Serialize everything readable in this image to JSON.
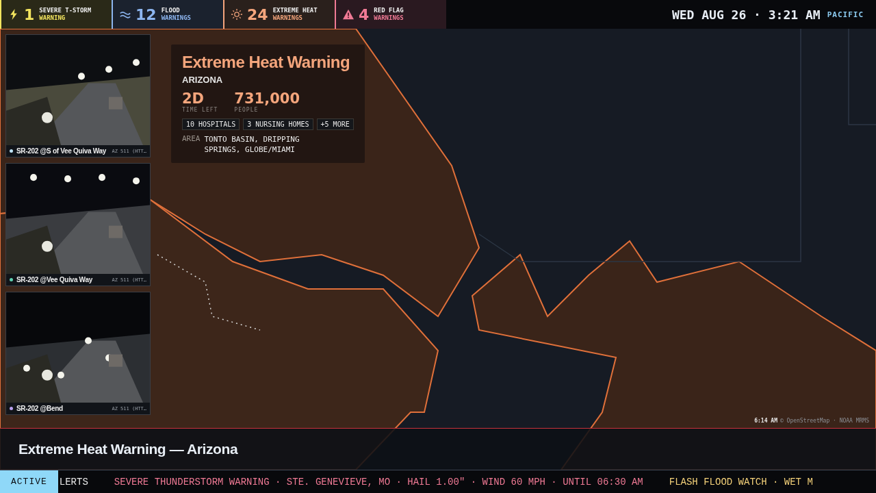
{
  "alert_summary": [
    {
      "kind": "storm",
      "count": "1",
      "label": "SEVERE T-STORM",
      "sublabel": "WARNING",
      "color": "#f2e45e"
    },
    {
      "kind": "flood",
      "count": "12",
      "label": "FLOOD",
      "sublabel": "WARNINGS",
      "color": "#8db6f0"
    },
    {
      "kind": "heat",
      "count": "24",
      "label": "EXTREME HEAT",
      "sublabel": "WARNINGS",
      "color": "#f4a57c"
    },
    {
      "kind": "fire",
      "count": "4",
      "label": "RED FLAG",
      "sublabel": "WARNINGS",
      "color": "#f07a95"
    }
  ],
  "clock": {
    "datetime": "WED AUG 26 · 3:21 AM",
    "timezone": "PACIFIC"
  },
  "cameras": [
    {
      "name": "SR-202 @S of Vee Quiva Way",
      "source": "AZ 511 (HTT…",
      "color": "#bfe3f5"
    },
    {
      "name": "SR-202 @Vee Quiva Way",
      "source": "AZ 511 (HTT…",
      "color": "#5fd0b0"
    },
    {
      "name": "SR-202 @Bend",
      "source": "AZ 511 (HTT…",
      "color": "#b9a0f0"
    }
  ],
  "alert_card": {
    "title": "Extreme Heat Warning",
    "region": "ARIZONA",
    "stats": [
      {
        "value": "2D",
        "label": "TIME LEFT"
      },
      {
        "value": "731,000",
        "label": "PEOPLE"
      }
    ],
    "tags": [
      "10 HOSPITALS",
      "3 NURSING HOMES",
      "+5 MORE"
    ],
    "area_label": "AREA",
    "area": "TONTO BASIN, DRIPPING SPRINGS, GLOBE/MIAMI"
  },
  "map": {
    "kind": "picture",
    "attribution_time": "6:14 AM",
    "attribution": "© OpenStreetMap · NOAA MRMS"
  },
  "headline": "Extreme Heat Warning — Arizona",
  "ticker": {
    "badge": "ACTIVE",
    "lead": "LERTS",
    "items": [
      {
        "text": "SEVERE THUNDERSTORM WARNING · STE. GENEVIEVE, MO · HAIL 1.00\" · WIND 60 MPH · UNTIL 06:30 AM",
        "color": "#f07a95"
      },
      {
        "text": "FLASH FLOOD WATCH · WET M",
        "color": "#f5d27a"
      }
    ]
  }
}
